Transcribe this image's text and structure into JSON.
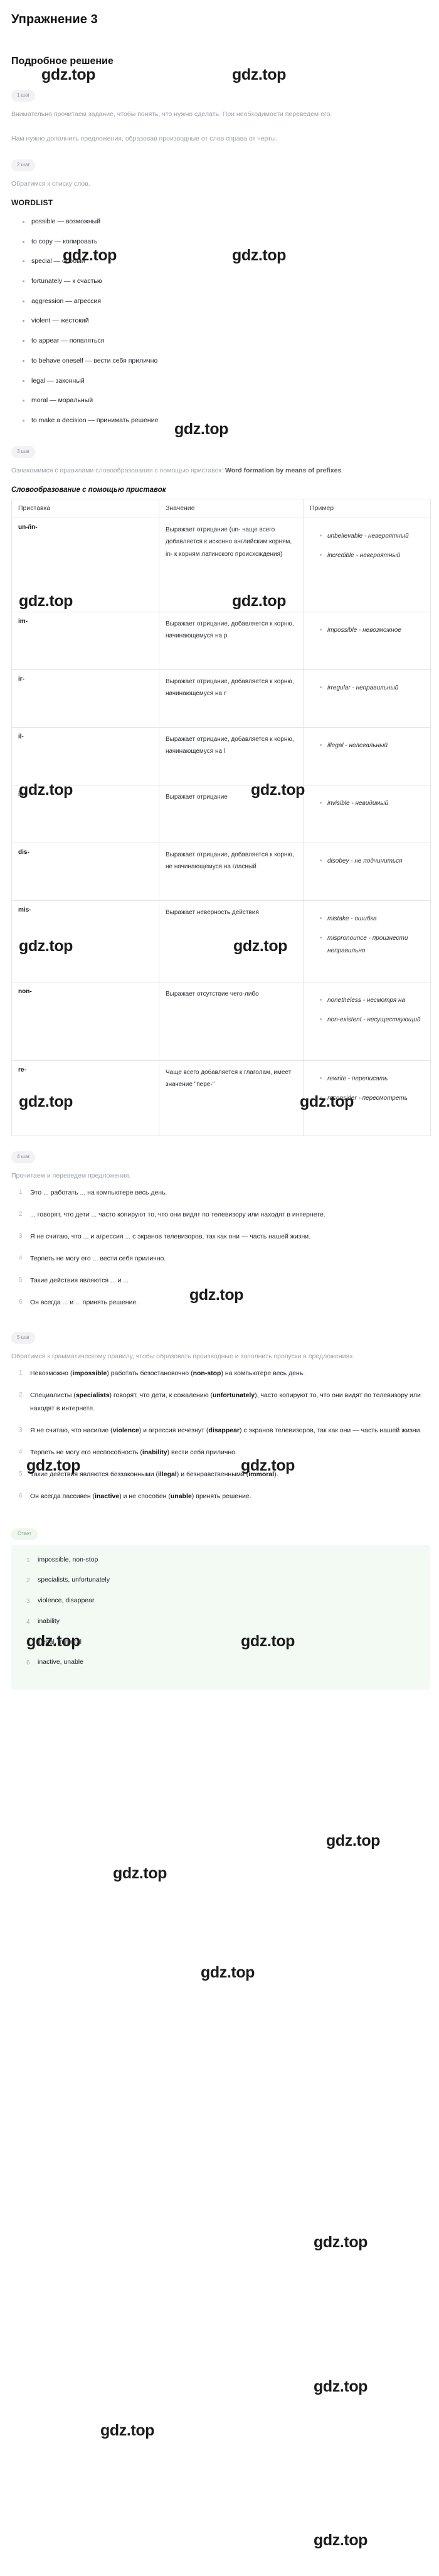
{
  "header": {
    "exercise_title": "Упражнение 3",
    "solution_title": "Подробное решение"
  },
  "watermark": {
    "text": "gdz.top"
  },
  "steps": {
    "step1_chip": "1 шаг",
    "step1_text": "Внимательно прочитаем задание, чтобы понять, что нужно сделать. При необходимости переведем его.",
    "step1_text2": "Нам нужно дополнить предложения, образовав производные от слов справа от черты.",
    "step2_chip": "2 шаг",
    "step2_text": "Обратимся к списку слов.",
    "wordlist_heading": "WORDLIST",
    "step3_chip": "3 шаг",
    "step3_text_plain": "Ознакомимся с правилами словообразования с помощью приставок: ",
    "step3_text_bold": "Word formation by means of prefixes",
    "step3_text_tail": ".",
    "table_caption": "Словообразование с помощью приставок",
    "step4_chip": "4 шаг",
    "step4_text": "Прочитаем и переведем предложения.",
    "step5_chip": "5 шаг",
    "step5_text": "Обратимся к грамматическому правилу, чтобы образовать производные и заполнить пропуски в предложениях.",
    "answer_chip": "Ответ"
  },
  "wordlist": [
    "possible — возможный",
    "to copy — копировать",
    "special — особый",
    "fortunately — к счастью",
    "aggression — агрессия",
    "violent — жестокий",
    "to appear — появляться",
    "to behave oneself — вести себя прилично",
    "legal — законный",
    "moral — моральный",
    "to make a decision — принимать решение"
  ],
  "table": {
    "columns": [
      "Приставка",
      "Значение",
      "Пример"
    ],
    "rows": [
      {
        "prefix": "un-/in-",
        "meaning": "Выражает отрицание (un- чаще всего добавляется к исконно английским корням, in- к корням латинского происхождения)",
        "examples": [
          "unbelievable - невероятный",
          "incredible - невероятный"
        ]
      },
      {
        "prefix": "im-",
        "meaning": "Выражает отрицание, добавляется к корню, начинающемуся на p",
        "examples": [
          "impossible - невозможное"
        ]
      },
      {
        "prefix": "ir-",
        "meaning": "Выражает отрицание, добавляется к корню, начинающемуся на r",
        "examples": [
          "irregular - неправильный"
        ]
      },
      {
        "prefix": "il-",
        "meaning": "Выражает отрицание, добавляется к корню, начинающемуся на l",
        "examples": [
          "illegal - нелегальный"
        ]
      },
      {
        "prefix": "in-",
        "meaning": "Выражает отрицание",
        "examples": [
          "invisible - невидимый"
        ]
      },
      {
        "prefix": "dis-",
        "meaning": "Выражает отрицание, добавляется к корню, не начинающемуся на гласный",
        "examples": [
          "disobey - не подчиниться"
        ]
      },
      {
        "prefix": "mis-",
        "meaning": "Выражает неверность действия",
        "examples": [
          "mistake - ошибка",
          "mispronounce - произнести неправильно"
        ]
      },
      {
        "prefix": "non-",
        "meaning": "Выражает отсутствие чего-либо",
        "examples": [
          "nonetheless - несмотря на",
          "non-existent - несуществующий"
        ]
      },
      {
        "prefix": "re-",
        "meaning": "Чаще всего добавляется к глаголам, имеет значение \"пере-\"",
        "examples": [
          "rewrite - переписать",
          "reconsider - пересмотреть"
        ]
      }
    ]
  },
  "sentences_ru": [
    "Это ... работать ... на компьютере весь день.",
    "... говорят, что дети ... часто копируют то, что они видят по телевизору или находят в интернете.",
    "Я не считаю, что ... и агрессия ... с экранов телевизоров, так как они — часть нашей жизни.",
    "Терпеть не могу его ... вести себя прилично.",
    "Такие действия являются ... и ...",
    "Он всегда ... и ... принять решение."
  ],
  "sentences_filled": [
    {
      "pre": "Невозможно (",
      "b1": "impossible",
      "mid1": ") работать безостановочно (",
      "b2": "non-stop",
      "mid2": ") на компьютере весь день.",
      "tail": ""
    },
    {
      "pre": "Специалисты (",
      "b1": "specialists",
      "mid1": ") говорят, что дети, к сожалению (",
      "b2": "unfortunately",
      "mid2": "), часто копируют то, что они видят по телевизору или находят в интернете.",
      "tail": ""
    },
    {
      "pre": "Я не считаю, что насилие (",
      "b1": "violence",
      "mid1": ") и агрессия исчезнут (",
      "b2": "disappear",
      "mid2": ") с экранов телевизоров, так как они — часть нашей жизни.",
      "tail": ""
    },
    {
      "pre": "Терпеть не могу его неспособность (",
      "b1": "inability",
      "mid1": ") вести себя прилично.",
      "b2": "",
      "mid2": "",
      "tail": ""
    },
    {
      "pre": "Такие действия являются беззаконными (",
      "b1": "illegal",
      "mid1": ") и безнравственными (",
      "b2": "immoral",
      "mid2": ").",
      "tail": ""
    },
    {
      "pre": "Он всегда пассивен (",
      "b1": "inactive",
      "mid1": ") и не способен (",
      "b2": "unable",
      "mid2": ") принять решение.",
      "tail": ""
    }
  ],
  "answers": [
    "impossible, non-stop",
    "specialists, unfortunately",
    "violence, disappear",
    "inability",
    "illegal, immoral",
    "inactive, unable"
  ]
}
